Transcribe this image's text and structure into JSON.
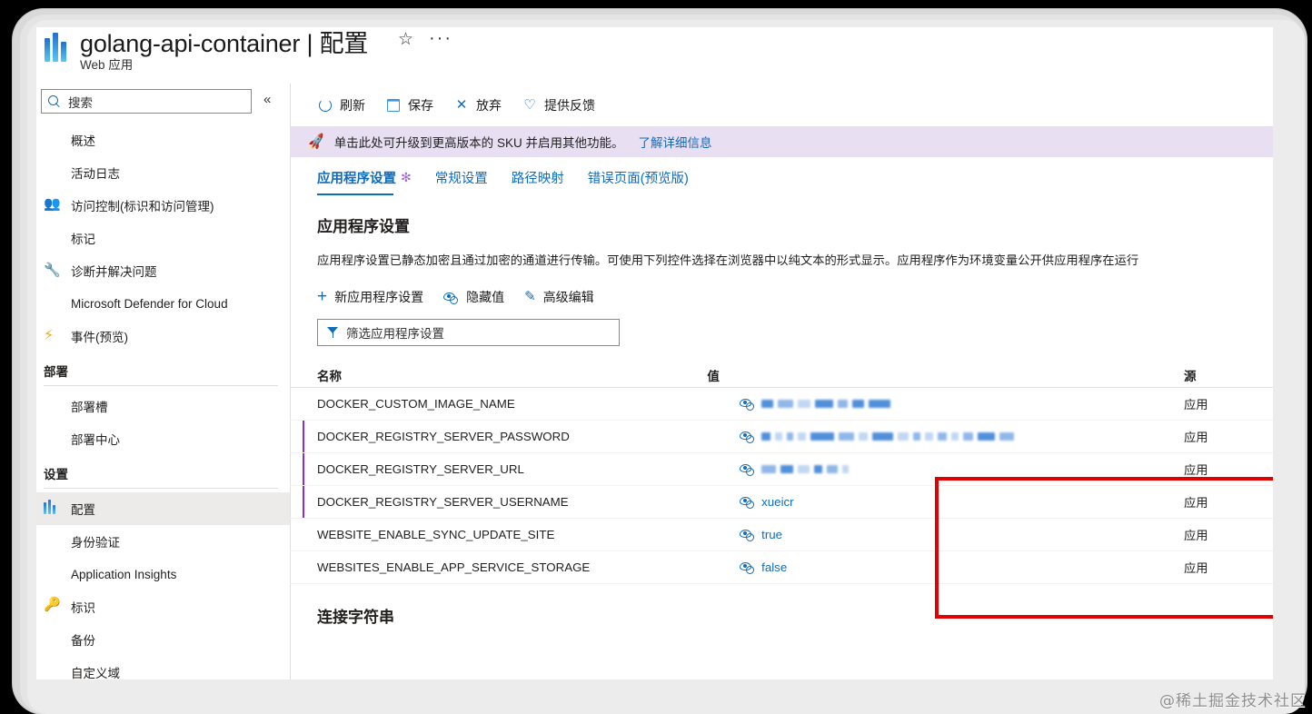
{
  "header": {
    "title": "golang-api-container | 配置",
    "subtitle": "Web 应用",
    "favorite_icon": "☆",
    "more_icon": "···"
  },
  "sidebar": {
    "search_placeholder": "搜索",
    "collapse_icon": "«",
    "items": [
      {
        "label": "概述",
        "icon": "globe-icon"
      },
      {
        "label": "活动日志",
        "icon": "activity-log-icon"
      },
      {
        "label": "访问控制(标识和访问管理)",
        "icon": "access-control-icon"
      },
      {
        "label": "标记",
        "icon": "tag-icon"
      },
      {
        "label": "诊断并解决问题",
        "icon": "wrench-icon"
      },
      {
        "label": "Microsoft Defender for Cloud",
        "icon": "shield-icon"
      },
      {
        "label": "事件(预览)",
        "icon": "bolt-icon"
      }
    ],
    "group_deploy": {
      "title": "部署",
      "items": [
        {
          "label": "部署槽",
          "icon": "deployment-slot-icon"
        },
        {
          "label": "部署中心",
          "icon": "deployment-center-icon"
        }
      ]
    },
    "group_settings": {
      "title": "设置",
      "items": [
        {
          "label": "配置",
          "icon": "configuration-icon",
          "selected": true
        },
        {
          "label": "身份验证",
          "icon": "authentication-icon"
        },
        {
          "label": "Application Insights",
          "icon": "app-insights-icon"
        },
        {
          "label": "标识",
          "icon": "identity-icon"
        },
        {
          "label": "备份",
          "icon": "backup-icon"
        },
        {
          "label": "自定义域",
          "icon": "custom-domain-icon"
        }
      ]
    }
  },
  "toolbar": {
    "refresh_label": "刷新",
    "save_label": "保存",
    "discard_label": "放弃",
    "feedback_label": "提供反馈"
  },
  "banner": {
    "rocket_icon": "🚀",
    "text": "单击此处可升级到更高版本的 SKU 并启用其他功能。",
    "link": "了解详细信息",
    "background": "#e8dff3"
  },
  "tabs": [
    {
      "label": "应用程序设置",
      "dirty": "✻",
      "active": true
    },
    {
      "label": "常规设置",
      "dirty": "",
      "active": false
    },
    {
      "label": "路径映射",
      "dirty": "",
      "active": false
    },
    {
      "label": "错误页面(预览版)",
      "dirty": "",
      "active": false
    }
  ],
  "section": {
    "title": "应用程序设置",
    "description": "应用程序设置已静态加密且通过加密的通道进行传输。可使用下列控件选择在浏览器中以纯文本的形式显示。应用程序作为环境变量公开供应用程序在运行"
  },
  "actions": {
    "new_setting": "新应用程序设置",
    "hide_values": "隐藏值",
    "advanced_edit": "高级编辑"
  },
  "filter": {
    "placeholder": "筛选应用程序设置"
  },
  "table": {
    "columns": {
      "name": "名称",
      "value": "值",
      "source": "源"
    },
    "rows": [
      {
        "name": "DOCKER_CUSTOM_IMAGE_NAME",
        "value": "",
        "redacted": true,
        "source": "应用",
        "marked": false
      },
      {
        "name": "DOCKER_REGISTRY_SERVER_PASSWORD",
        "value": "",
        "redacted": true,
        "source": "应用",
        "marked": true
      },
      {
        "name": "DOCKER_REGISTRY_SERVER_URL",
        "value": "",
        "redacted": true,
        "source": "应用",
        "marked": true
      },
      {
        "name": "DOCKER_REGISTRY_SERVER_USERNAME",
        "value": "xueicr",
        "redacted": false,
        "source": "应用",
        "marked": true
      },
      {
        "name": "WEBSITE_ENABLE_SYNC_UPDATE_SITE",
        "value": "true",
        "redacted": false,
        "source": "应用",
        "marked": false
      },
      {
        "name": "WEBSITES_ENABLE_APP_SERVICE_STORAGE",
        "value": "false",
        "redacted": false,
        "source": "应用",
        "marked": false
      }
    ]
  },
  "bottom_section": {
    "title": "连接字符串"
  },
  "highlight": {
    "color": "#e00000"
  },
  "watermark": {
    "text": "@稀土掘金技术社区"
  }
}
